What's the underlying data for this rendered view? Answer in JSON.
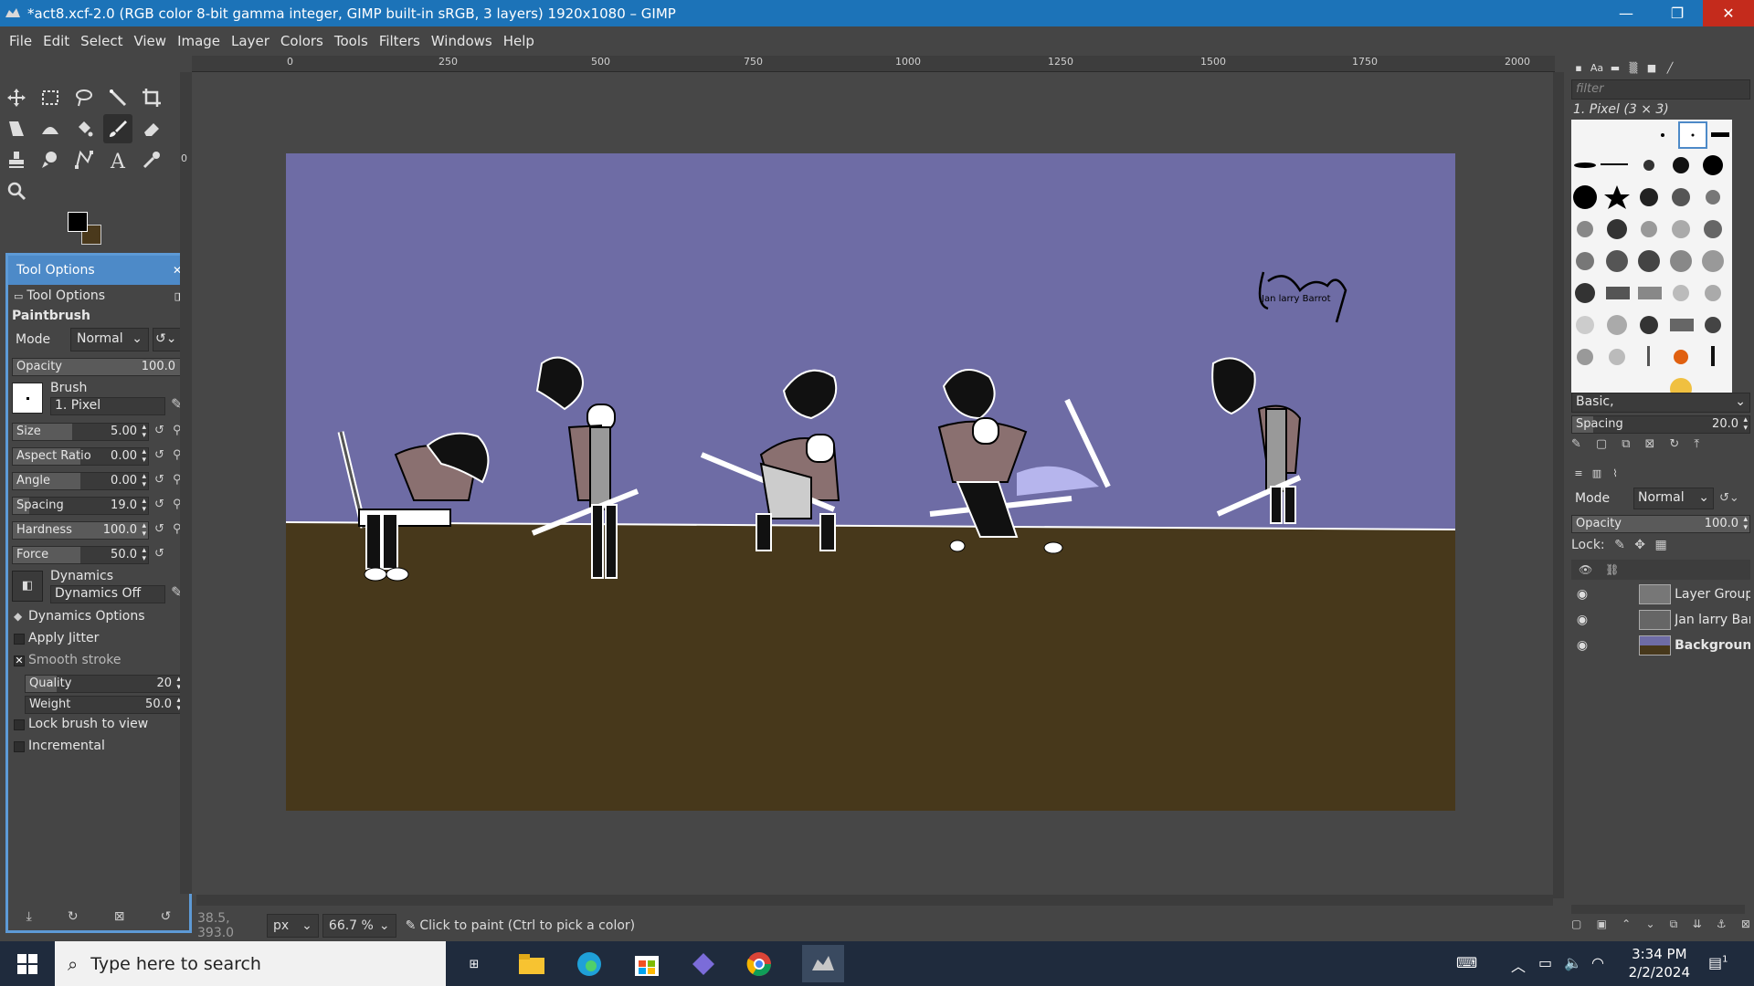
{
  "window": {
    "title": "*act8.xcf-2.0 (RGB color 8-bit gamma integer, GIMP built-in sRGB, 3 layers) 1920x1080 – GIMP",
    "minimize": "—",
    "restore": "❐",
    "close": "✕"
  },
  "menu": [
    "File",
    "Edit",
    "Select",
    "View",
    "Image",
    "Layer",
    "Colors",
    "Tools",
    "Filters",
    "Windows",
    "Help"
  ],
  "tool_options": {
    "panel_title": "Tool Options",
    "tab_label": "Tool Options",
    "tool_name": "Paintbrush",
    "mode_label": "Mode",
    "mode_value": "Normal",
    "opacity_label": "Opacity",
    "opacity_value": "100.0",
    "brush_label": "Brush",
    "brush_value": "1. Pixel",
    "size_label": "Size",
    "size_value": "5.00",
    "aspect_label": "Aspect Ratio",
    "aspect_value": "0.00",
    "angle_label": "Angle",
    "angle_value": "0.00",
    "spacing_label": "Spacing",
    "spacing_value": "19.0",
    "hardness_label": "Hardness",
    "hardness_value": "100.0",
    "force_label": "Force",
    "force_value": "50.0",
    "dynamics_label": "Dynamics",
    "dynamics_value": "Dynamics Off",
    "dynamics_options": "Dynamics Options",
    "apply_jitter": "Apply Jitter",
    "smooth_stroke": "Smooth stroke",
    "quality_label": "Quality",
    "quality_value": "20",
    "weight_label": "Weight",
    "weight_value": "50.0",
    "lock_brush": "Lock brush to view",
    "incremental": "Incremental"
  },
  "rulers": {
    "top": [
      "0",
      "250",
      "500",
      "750",
      "1000",
      "1250",
      "1500",
      "1750",
      "2000"
    ],
    "left": [
      "0"
    ]
  },
  "statusbar": {
    "coords": "38.5, 393.0",
    "unit": "px",
    "zoom": "66.7 %",
    "message": "Click to paint (Ctrl to pick a color)"
  },
  "right_dock": {
    "filter_placeholder": "filter",
    "brush_name": "1. Pixel (3 × 3)",
    "preset": "Basic,",
    "spacing_label": "Spacing",
    "spacing_value": "20.0",
    "mode_label": "Mode",
    "mode_value": "Normal",
    "opacity_label": "Opacity",
    "opacity_value": "100.0",
    "lock_label": "Lock:",
    "layers": [
      {
        "name": "Layer Group"
      },
      {
        "name": "Jan larry Barr"
      },
      {
        "name": "Backgrounc"
      }
    ]
  },
  "canvas": {
    "signature": "Janlarry",
    "signature_sub": "Jan larry Barrot"
  },
  "taskbar": {
    "search_placeholder": "Type here to search",
    "time": "3:34 PM",
    "date": "2/2/2024",
    "notif_count": "1"
  },
  "colors": {
    "sky": "#6e6ca5",
    "ground": "#47381b",
    "titlebar": "#1c73b8",
    "panel_accent": "#4d8ac8"
  }
}
